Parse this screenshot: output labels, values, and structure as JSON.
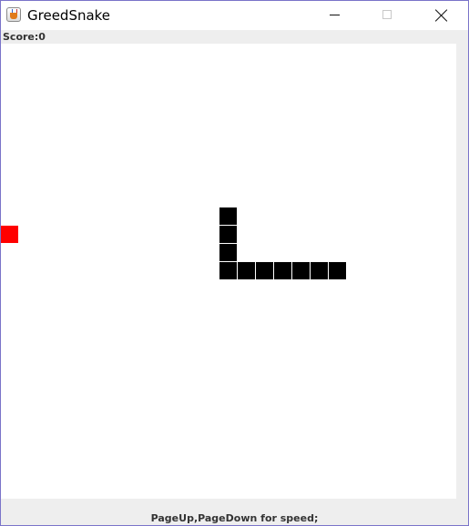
{
  "window": {
    "title": "GreedSnake",
    "icon": "java-cup-icon"
  },
  "status": {
    "score_text": "Score:0"
  },
  "board": {
    "grid_columns": 25,
    "grid_rows": 25,
    "background_color": "#ffffff",
    "snake_color": "#000000",
    "food_color": "#ff0000",
    "snake": [
      {
        "col": 12,
        "row": 9
      },
      {
        "col": 12,
        "row": 10
      },
      {
        "col": 12,
        "row": 11
      },
      {
        "col": 12,
        "row": 12
      },
      {
        "col": 13,
        "row": 12
      },
      {
        "col": 14,
        "row": 12
      },
      {
        "col": 15,
        "row": 12
      },
      {
        "col": 16,
        "row": 12
      },
      {
        "col": 17,
        "row": 12
      },
      {
        "col": 18,
        "row": 12
      }
    ],
    "food": {
      "col": 0,
      "row": 10
    }
  },
  "footer": {
    "hint_text": "PageUp,PageDown for speed;"
  }
}
